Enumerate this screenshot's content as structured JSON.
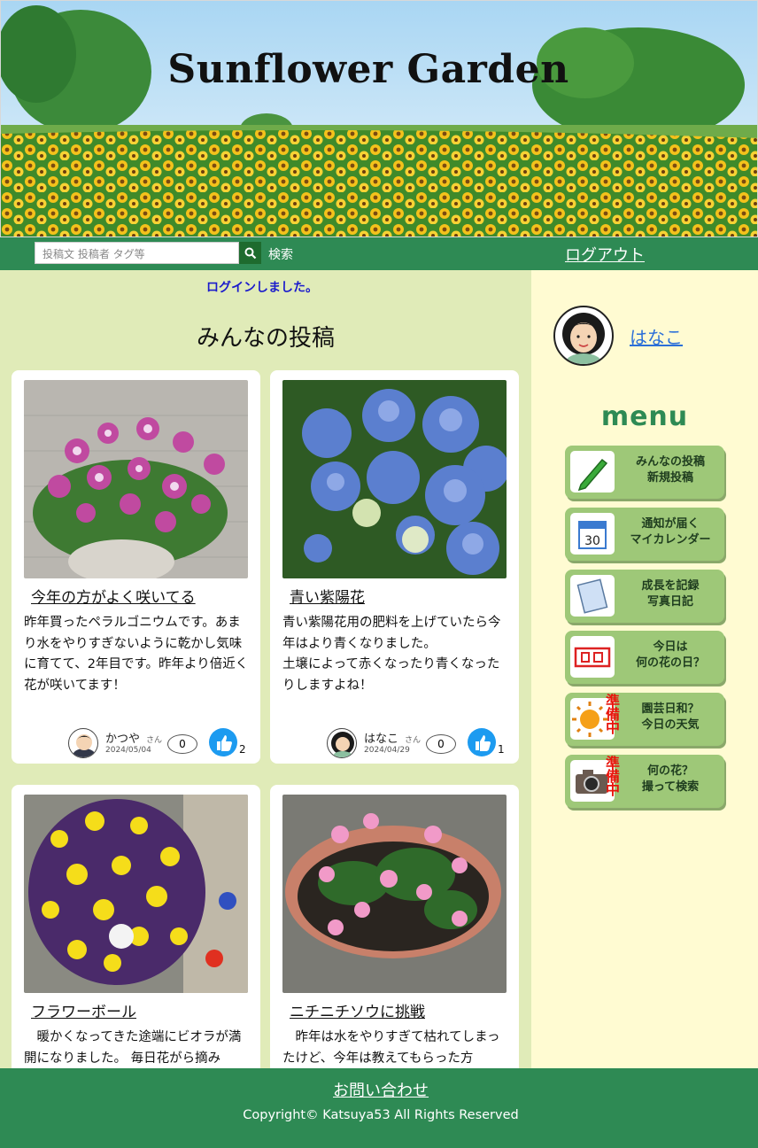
{
  "header": {
    "title": "Sunflower Garden"
  },
  "topbar": {
    "search_placeholder": "投稿文 投稿者 タグ等",
    "search_label": "検索",
    "logout_label": "ログアウト"
  },
  "flash": "ログインしました。",
  "page_title": "みんなの投稿",
  "posts": [
    {
      "title": "今年の方がよく咲いてる",
      "body": "昨年買ったペラルゴニウムです。あまり水をやりすぎないように乾かし気味に育てて、2年目です。昨年より倍近く花が咲いてます！",
      "author": "かつや",
      "honorific": "さん",
      "date": "2024/05/04",
      "comments": "0",
      "likes": "2"
    },
    {
      "title": "青い紫陽花",
      "body": "青い紫陽花用の肥料を上げていたら今年はより青くなりました。\n土壌によって赤くなったり青くなったりしますよね！",
      "author": "はなこ",
      "honorific": "さん",
      "date": "2024/04/29",
      "comments": "0",
      "likes": "1"
    },
    {
      "title": "フラワーボール",
      "body": "　暖かくなってきた途端にビオラが満開になりました。 毎日花がら摘み",
      "author": "",
      "honorific": "",
      "date": "",
      "comments": "",
      "likes": ""
    },
    {
      "title": "ニチニチソウに挑戦",
      "body": "　昨年は水をやりすぎて枯れてしまったけど、今年は教えてもらった方",
      "author": "",
      "honorific": "",
      "date": "",
      "comments": "",
      "likes": ""
    }
  ],
  "sidebar": {
    "username": "はなこ",
    "menu_title": "menu",
    "prep_label": "準備中",
    "items": [
      {
        "label": "みんなの投稿\n新規投稿",
        "icon": "pencil-icon",
        "prep": false
      },
      {
        "label": "通知が届く\nマイカレンダー",
        "icon": "calendar-icon",
        "prep": false
      },
      {
        "label": "成長を記録\n写真日記",
        "icon": "notebook-icon",
        "prep": false
      },
      {
        "label": "今日は\n何の花の日？",
        "icon": "today-stamp-icon",
        "prep": false
      },
      {
        "label": "園芸日和？\n今日の天気",
        "icon": "sun-icon",
        "prep": true
      },
      {
        "label": "何の花？\n撮って検索",
        "icon": "camera-icon",
        "prep": true
      }
    ]
  },
  "footer": {
    "contact_label": "お問い合わせ",
    "copyright": "Copyright© Katsuya53 All Rights Reserved"
  },
  "colors": {
    "header_green": "#2e8a54",
    "main_bg": "#e0ebb8",
    "sidebar_bg": "#fffbd2",
    "menu_button": "#9ec878",
    "flash_blue": "#1a1acc",
    "link_blue": "#2b6fd8"
  }
}
